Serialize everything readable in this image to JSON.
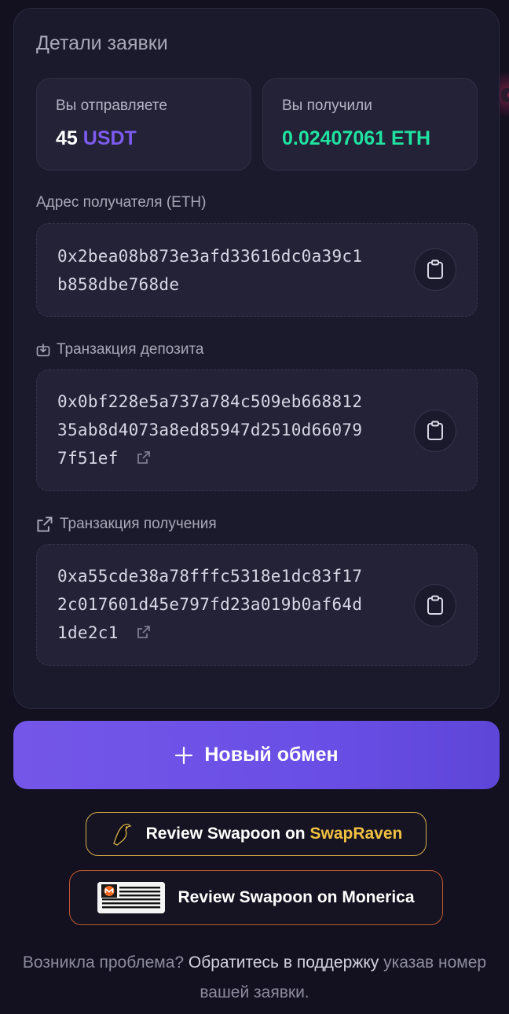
{
  "card": {
    "title": "Детали заявки"
  },
  "send": {
    "label": "Вы отправляете",
    "amount": "45",
    "currency": "USDT"
  },
  "receive": {
    "label": "Вы получили",
    "value": "0.02407061 ETH"
  },
  "recipient": {
    "label": "Адрес получателя (ETH)",
    "lines": [
      "0x2bea08b873e3afd33616dc0a39c1",
      "b858dbe768de"
    ]
  },
  "deposit_tx": {
    "label": "Транзакция депозита",
    "lines": [
      "0x0bf228e5a737a784c509eb668812",
      "35ab8d4073a8ed85947d2510d66079",
      "7f51ef"
    ]
  },
  "payout_tx": {
    "label": "Транзакция получения",
    "lines": [
      "0xa55cde38a78fffc5318e1dc83f17",
      "2c017601d45e797fd23a019b0af64d",
      "1de2c1"
    ]
  },
  "new_exchange": {
    "label": "Новый обмен"
  },
  "reviews": {
    "raven_prefix": "Review Swapoon on ",
    "raven_brand": "SwapRaven",
    "monerica_label": "Review Swapoon on Monerica"
  },
  "footer": {
    "part1": "Возникла проблема? ",
    "link": "Обратитесь в поддержку",
    "part2": " указав номер вашей заявки."
  },
  "colors": {
    "accent_purple": "#7c5cf0",
    "accent_green": "#1fe3a1",
    "raven_gold": "#f0c040",
    "monerica_orange": "#c25a2a"
  },
  "icons": [
    "download-icon",
    "external-link-icon",
    "clipboard-icon",
    "plus-icon",
    "raven-logo",
    "monero-logo"
  ]
}
